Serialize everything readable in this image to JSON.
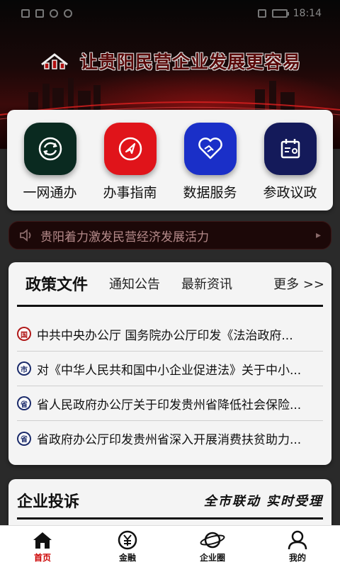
{
  "status_bar": {
    "time": "18:14"
  },
  "header": {
    "slogan": "让贵阳民营企业发展更容易"
  },
  "services": [
    {
      "label": "一网通办",
      "icon": "globe-refresh-icon",
      "color": "#0a2a20"
    },
    {
      "label": "办事指南",
      "icon": "compass-icon",
      "color": "#e0141a"
    },
    {
      "label": "数据服务",
      "icon": "heart-handshake-icon",
      "color": "#1a2fc8"
    },
    {
      "label": "参政议政",
      "icon": "calendar-person-icon",
      "color": "#141a5a"
    }
  ],
  "ticker": {
    "text": "贵阳着力激发民营经济发展活力"
  },
  "news": {
    "tabs": [
      {
        "label": "政策文件",
        "active": true
      },
      {
        "label": "通知公告",
        "active": false
      },
      {
        "label": "最新资讯",
        "active": false
      }
    ],
    "more_label": "更多 >>",
    "items": [
      {
        "badge": "国",
        "badge_color": "#b01818",
        "title": "中共中央办公厅 国务院办公厅印发《法治政府..."
      },
      {
        "badge": "市",
        "badge_color": "#1a2a6a",
        "title": "对《中华人民共和国中小企业促进法》关于中小..."
      },
      {
        "badge": "省",
        "badge_color": "#1a2a6a",
        "title": "省人民政府办公厅关于印发贵州省降低社会保险..."
      },
      {
        "badge": "省",
        "badge_color": "#1a2a6a",
        "title": "省政府办公厅印发贵州省深入开展消费扶贫助力..."
      }
    ]
  },
  "complaint": {
    "title": "企业投诉",
    "slogan": "全市联动 实时受理"
  },
  "bottom_nav": [
    {
      "label": "首页",
      "icon": "home-icon",
      "active": true
    },
    {
      "label": "金融",
      "icon": "yuan-icon",
      "active": false
    },
    {
      "label": "企业圈",
      "icon": "planet-icon",
      "active": false
    },
    {
      "label": "我的",
      "icon": "user-icon",
      "active": false
    }
  ],
  "colors": {
    "accent": "#c00000",
    "dark_red": "#5a0a0a"
  }
}
